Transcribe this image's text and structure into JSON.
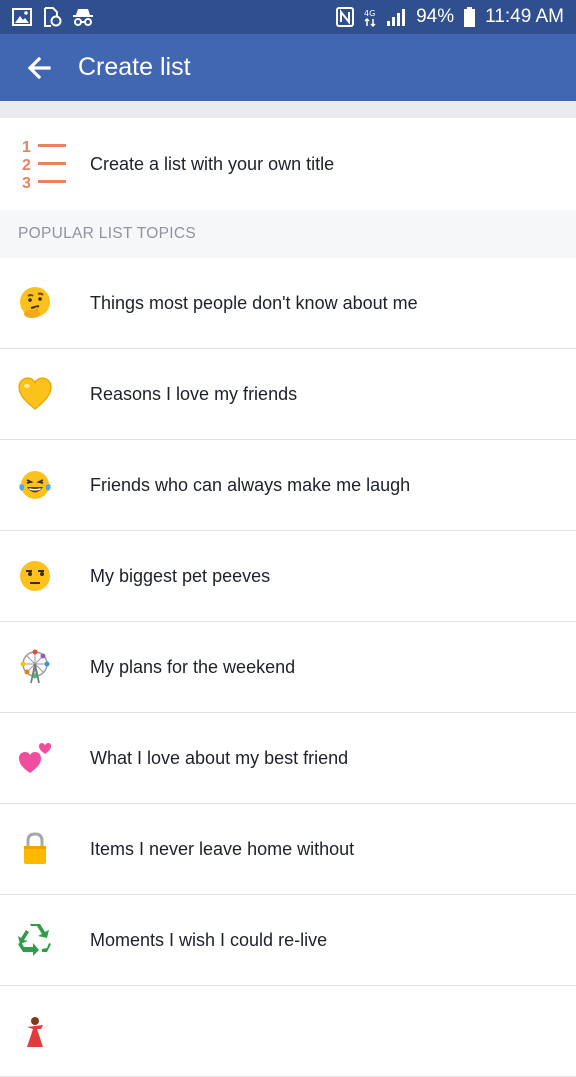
{
  "status_bar": {
    "battery": "94%",
    "time": "11:49 AM"
  },
  "header": {
    "title": "Create list"
  },
  "create_custom": {
    "label": "Create a list with your own title",
    "icon_digits": [
      "1",
      "2",
      "3"
    ]
  },
  "section": {
    "header": "POPULAR LIST TOPICS"
  },
  "topics": [
    {
      "label": "Things most people don't know about me",
      "icon": "thinking-face-icon"
    },
    {
      "label": "Reasons I love my friends",
      "icon": "yellow-heart-icon"
    },
    {
      "label": "Friends who can always make me laugh",
      "icon": "tears-of-joy-icon"
    },
    {
      "label": "My biggest pet peeves",
      "icon": "unamused-face-icon"
    },
    {
      "label": "My plans for the weekend",
      "icon": "ferris-wheel-icon"
    },
    {
      "label": "What I love about my best friend",
      "icon": "two-hearts-icon"
    },
    {
      "label": "Items I never leave home without",
      "icon": "lock-icon"
    },
    {
      "label": "Moments I wish I could re-live",
      "icon": "recycle-icon"
    },
    {
      "label": "",
      "icon": "dancer-icon"
    }
  ],
  "colors": {
    "status_bar": "#2f4f8f",
    "app_bar": "#4267b2",
    "list_icon_accent": "#e9825d",
    "section_bg": "#f6f7f9"
  }
}
